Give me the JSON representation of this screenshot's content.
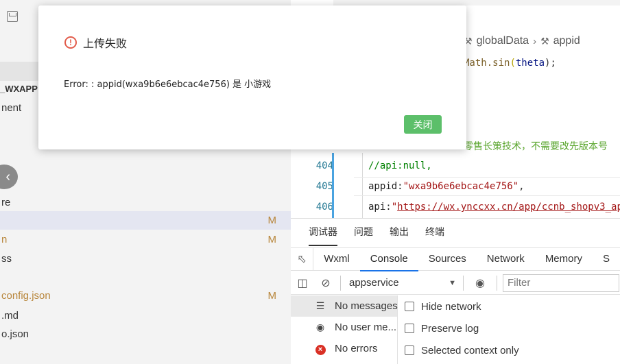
{
  "explorer": {
    "panel_title": "_WXAPP",
    "files": [
      {
        "label": "nent",
        "badge": "",
        "modified": false,
        "selected": false
      },
      {
        "label": "re",
        "badge": "",
        "modified": false,
        "selected": false
      },
      {
        "label": "",
        "badge": "M",
        "modified": true,
        "selected": true
      },
      {
        "label": "n",
        "badge": "M",
        "modified": true,
        "selected": false
      },
      {
        "label": "ss",
        "badge": "",
        "modified": false,
        "selected": false
      },
      {
        "label": "config.json",
        "badge": "M",
        "modified": true,
        "selected": false
      },
      {
        "label": ".md",
        "badge": "",
        "modified": false,
        "selected": false
      },
      {
        "label": "o.json",
        "badge": "",
        "modified": false,
        "selected": false
      }
    ],
    "back_icon": "chevron-left-icon"
  },
  "editor": {
    "breadcrumb": [
      "globalData",
      "appid"
    ],
    "code_top": {
      "fn": "Math.sin",
      "arg": "theta",
      "tail": ");"
    },
    "cn_comment": "零售长策技术，不需要改先版本号",
    "lines": [
      {
        "no": "404",
        "comment": "//api:null,"
      },
      {
        "no": "405",
        "key": "appid:",
        "value": "\"wxa9b6e6ebcac4e756\"",
        "tail": ","
      },
      {
        "no": "406",
        "key": "api:",
        "quote": "\"",
        "url": "https://wx.ynccxx.cn/app/ccnb_shopv3_ap"
      }
    ]
  },
  "devtools": {
    "panel_tabs": [
      "调试器",
      "问题",
      "输出",
      "终端"
    ],
    "active_panel": 0,
    "tabs": [
      "Wxml",
      "Console",
      "Sources",
      "Network",
      "Memory",
      "S"
    ],
    "active_tab": 1,
    "context": "appservice",
    "filter_placeholder": "Filter",
    "sidebar": [
      {
        "icon": "list-icon",
        "label": "No messages",
        "active": true
      },
      {
        "icon": "user-icon",
        "label": "No user me...",
        "active": false
      },
      {
        "icon": "error-icon",
        "label": "No errors",
        "active": false
      }
    ],
    "settings": [
      "Hide network",
      "Preserve log",
      "Selected context only"
    ]
  },
  "modal": {
    "title": "上传失败",
    "message": "Error: : appid(wxa9b6e6ebcac4e756) 是 小游戏",
    "close_label": "关闭",
    "colors": {
      "error": "#e25c4b",
      "button": "#5cbf6a"
    }
  }
}
